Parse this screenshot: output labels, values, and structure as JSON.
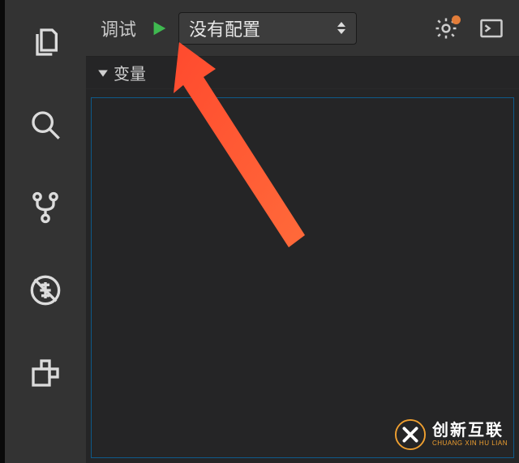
{
  "topbar": {
    "debug_label": "调试",
    "config_selected": "没有配置",
    "icons": {
      "play": "play-icon",
      "settings": "gear-icon",
      "console": "terminal-icon"
    }
  },
  "panel": {
    "variables_title": "变量"
  },
  "activity": {
    "items": [
      "files-icon",
      "search-icon",
      "source-control-icon",
      "debug-icon",
      "extensions-icon"
    ]
  },
  "watermark": {
    "cn": "创新互联",
    "en": "CHUANG XIN HU LIAN"
  }
}
